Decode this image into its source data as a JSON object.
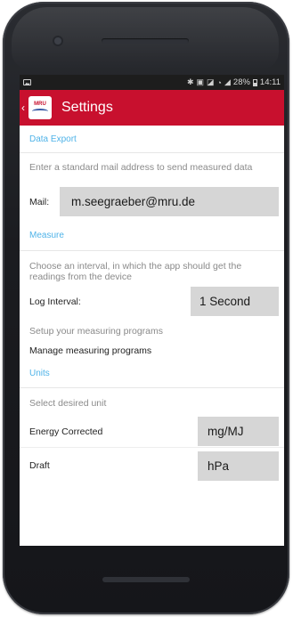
{
  "status_bar": {
    "icons": [
      "bluetooth-icon",
      "nfc-icon",
      "mute-icon",
      "wifi-icon",
      "signal-icon"
    ],
    "battery": "28%",
    "time": "14:11"
  },
  "app_bar": {
    "title": "Settings",
    "logo_text": "MRU",
    "color": "#c8102e"
  },
  "data_export": {
    "header": "Data Export",
    "description": "Enter a standard mail address to send measured data",
    "mail_label": "Mail:",
    "mail_value": "m.seegraeber@mru.de"
  },
  "measure": {
    "header": "Measure",
    "description": "Choose an interval, in which the app should get the readings from the device",
    "log_interval_label": "Log Interval:",
    "log_interval_value": "1 Second",
    "programs_description": "Setup your measuring programs",
    "manage_programs_label": "Manage measuring programs"
  },
  "units": {
    "header": "Units",
    "description": "Select desired unit",
    "energy_label": "Energy Corrected",
    "energy_value": "mg/MJ",
    "draft_label": "Draft",
    "draft_value": "hPa"
  },
  "accent_color": "#4fb3e8"
}
